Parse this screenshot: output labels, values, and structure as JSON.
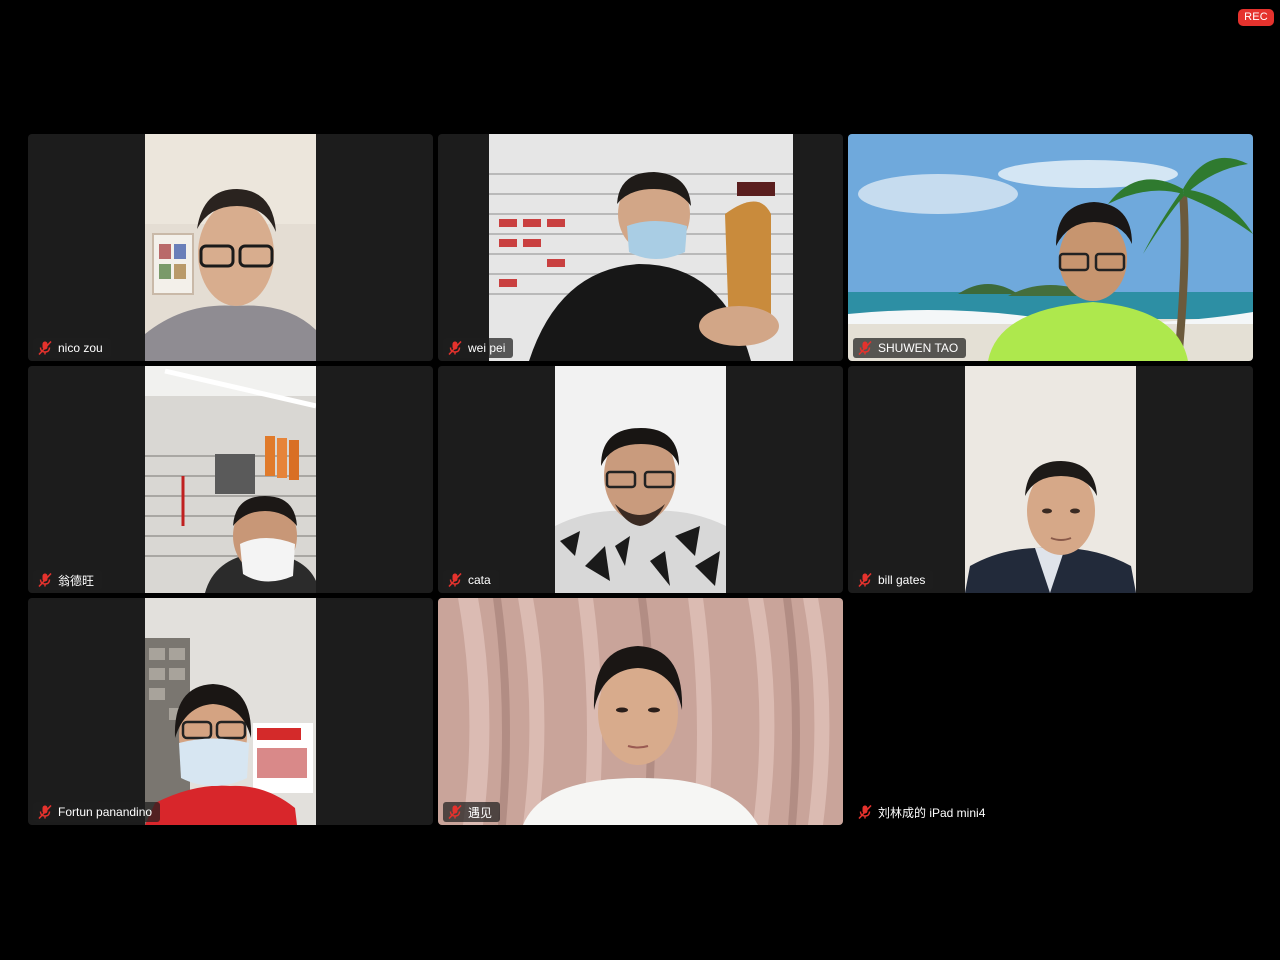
{
  "recording": {
    "label": "REC",
    "color": "#e5322d"
  },
  "participants": [
    {
      "name": "nico zou",
      "muted": true
    },
    {
      "name": "wei pei",
      "muted": true
    },
    {
      "name": "SHUWEN TAO",
      "muted": true
    },
    {
      "name": "翁德旺",
      "muted": true
    },
    {
      "name": "cata",
      "muted": true
    },
    {
      "name": "bill gates",
      "muted": true
    },
    {
      "name": "Fortun panandino",
      "muted": true
    },
    {
      "name": "遇见",
      "muted": true
    },
    {
      "name": "刘林成的 iPad mini4",
      "muted": true
    }
  ],
  "icons": {
    "muted_mic": "mic-muted-icon"
  },
  "colors": {
    "background": "#000000",
    "tile": "#1c1c1c",
    "muted_icon": "#e5322d"
  }
}
